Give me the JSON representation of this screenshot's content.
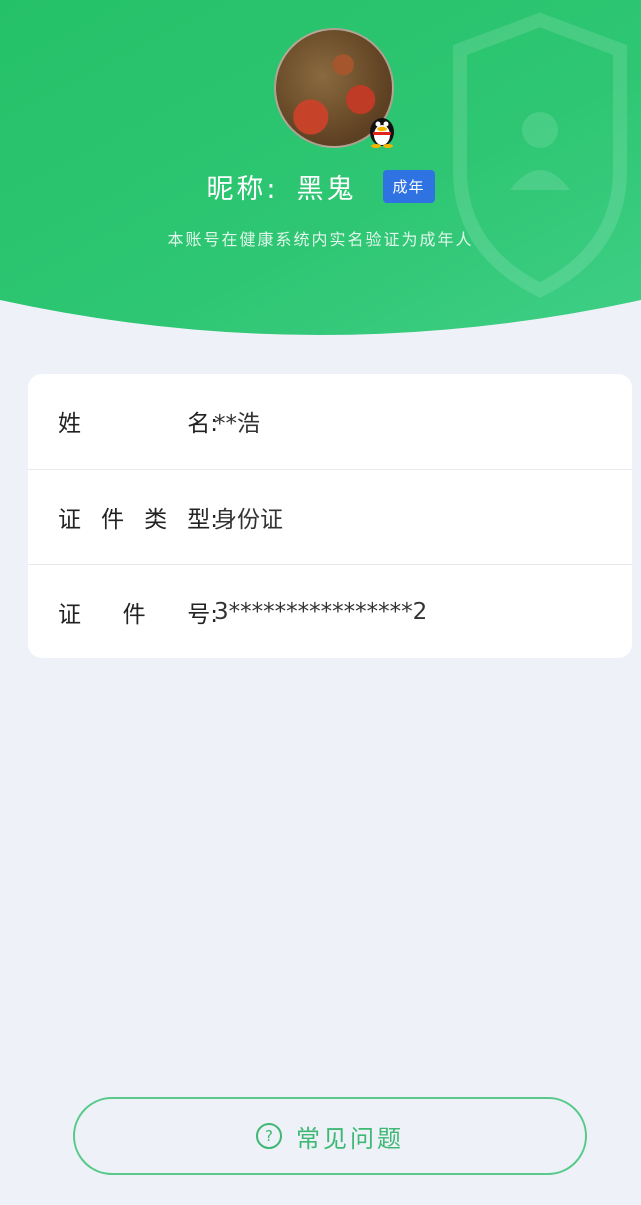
{
  "header": {
    "nickname_label": "昵称:",
    "nickname_value": "黑鬼",
    "age_badge": "成年",
    "verify_text": "本账号在健康系统内实名验证为成年人"
  },
  "info": {
    "name_label": [
      "姓",
      "名:"
    ],
    "name_value": "**浩",
    "id_type_label": [
      "证",
      "件",
      "类",
      "型:"
    ],
    "id_type_value": "身份证",
    "id_number_label": [
      "证",
      "件",
      "号:"
    ],
    "id_number_value": "3****************2"
  },
  "footer": {
    "faq_icon": "?",
    "faq_label": "常见问题"
  },
  "colors": {
    "header_green": "#2fc36e",
    "badge_blue": "#2f73e3",
    "button_green": "#3fb873",
    "page_bg": "#eef2f8"
  },
  "icons": {
    "avatar": "avatar-image",
    "qq": "qq-penguin-icon",
    "shield": "shield-watermark-icon",
    "faq": "question-circle-icon"
  }
}
